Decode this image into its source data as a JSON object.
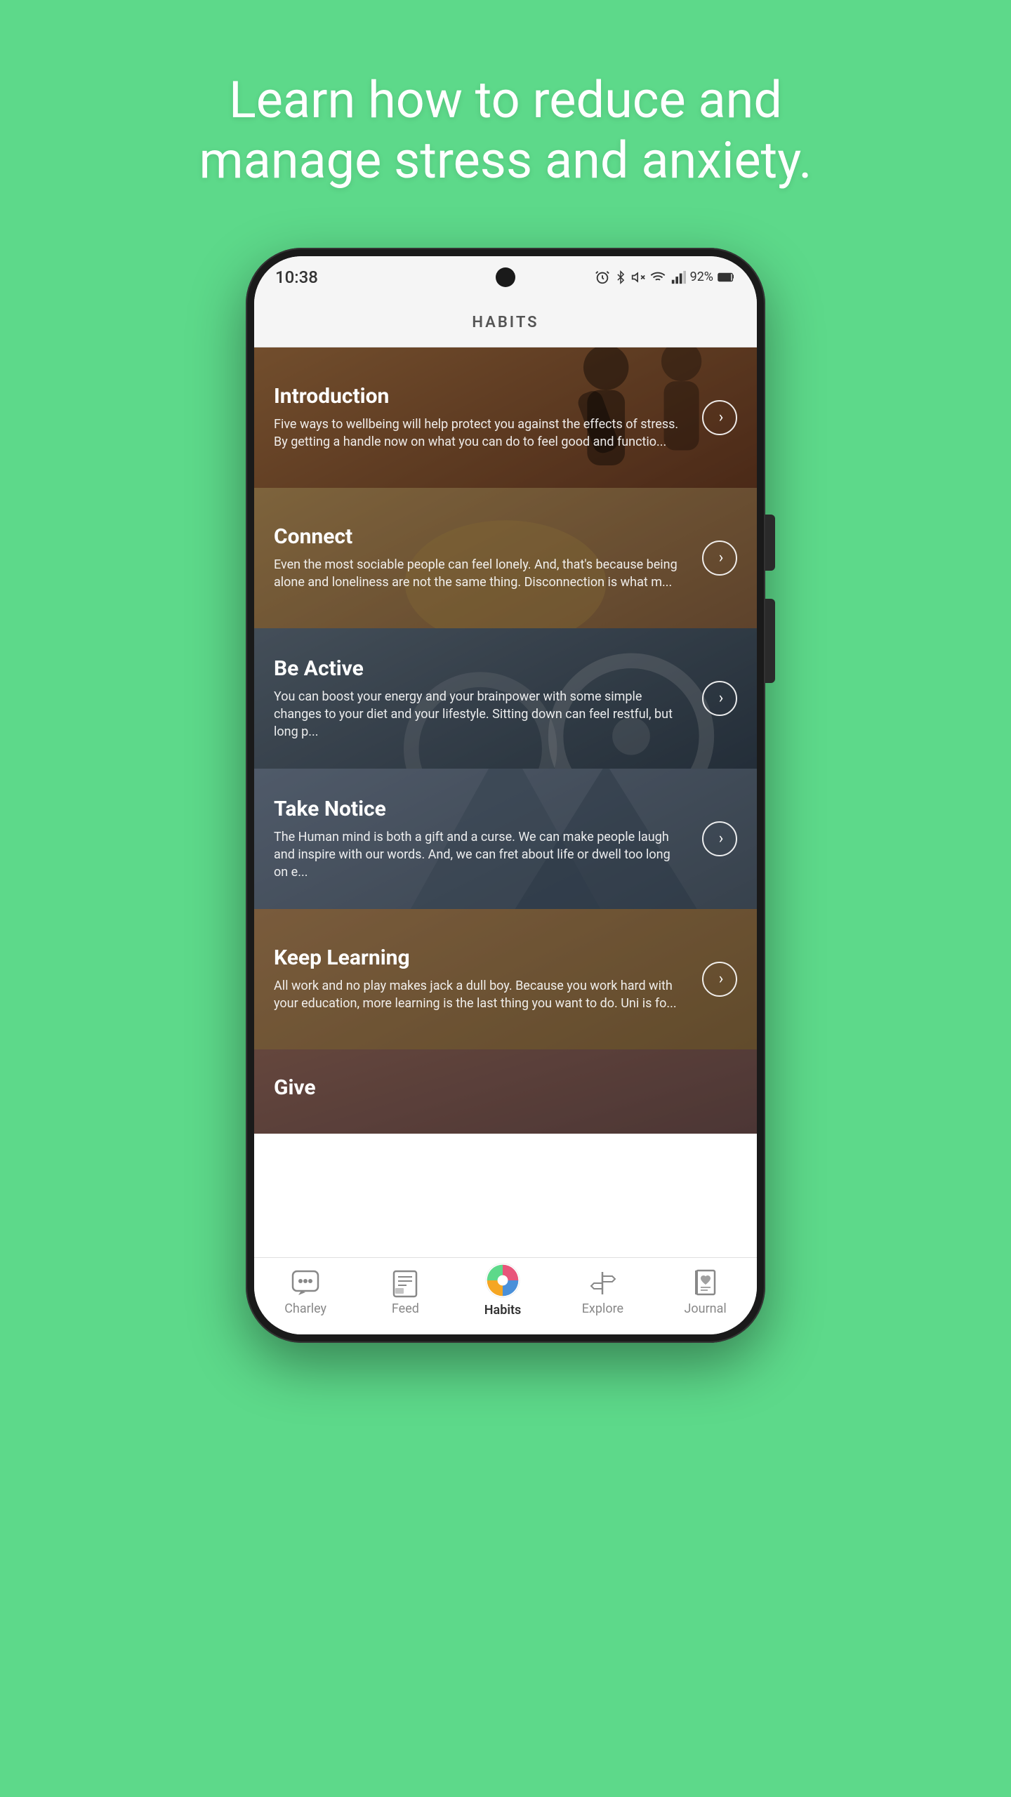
{
  "page": {
    "background_color": "#5dd98a",
    "headline_line1": "Learn how to reduce and",
    "headline_line2": "manage stress and anxiety."
  },
  "status_bar": {
    "time": "10:38",
    "battery": "92%",
    "signal": "VoLTE"
  },
  "app_header": {
    "title": "HABITS"
  },
  "cards": [
    {
      "id": "introduction",
      "title": "Introduction",
      "text": "Five ways to wellbeing will help protect you against the effects of stress. By getting a handle now on what you can do to feel good and functio...",
      "theme": "intro"
    },
    {
      "id": "connect",
      "title": "Connect",
      "text": "Even the most sociable people can feel lonely. And, that's because being alone and loneliness are not the same thing. Disconnection is what m...",
      "theme": "connect"
    },
    {
      "id": "be-active",
      "title": "Be Active",
      "text": "You can boost your energy and your brainpower with some simple changes to your diet and your lifestyle. Sitting down can feel restful, but long p...",
      "theme": "active"
    },
    {
      "id": "take-notice",
      "title": "Take Notice",
      "text": "The Human mind is both a gift and a curse. We can make people laugh and inspire with our words. And, we can fret about life or dwell too long on e...",
      "theme": "notice"
    },
    {
      "id": "keep-learning",
      "title": "Keep Learning",
      "text": "All work and no play makes jack a dull boy. Because you work hard with your education, more learning is the last thing you want to do. Uni is fo...",
      "theme": "learning"
    },
    {
      "id": "give",
      "title": "Give",
      "text": "",
      "theme": "give"
    }
  ],
  "bottom_nav": {
    "items": [
      {
        "id": "charley",
        "label": "Charley",
        "active": false
      },
      {
        "id": "feed",
        "label": "Feed",
        "active": false
      },
      {
        "id": "habits",
        "label": "Habits",
        "active": true
      },
      {
        "id": "explore",
        "label": "Explore",
        "active": false
      },
      {
        "id": "journal",
        "label": "Journal",
        "active": false
      }
    ]
  }
}
